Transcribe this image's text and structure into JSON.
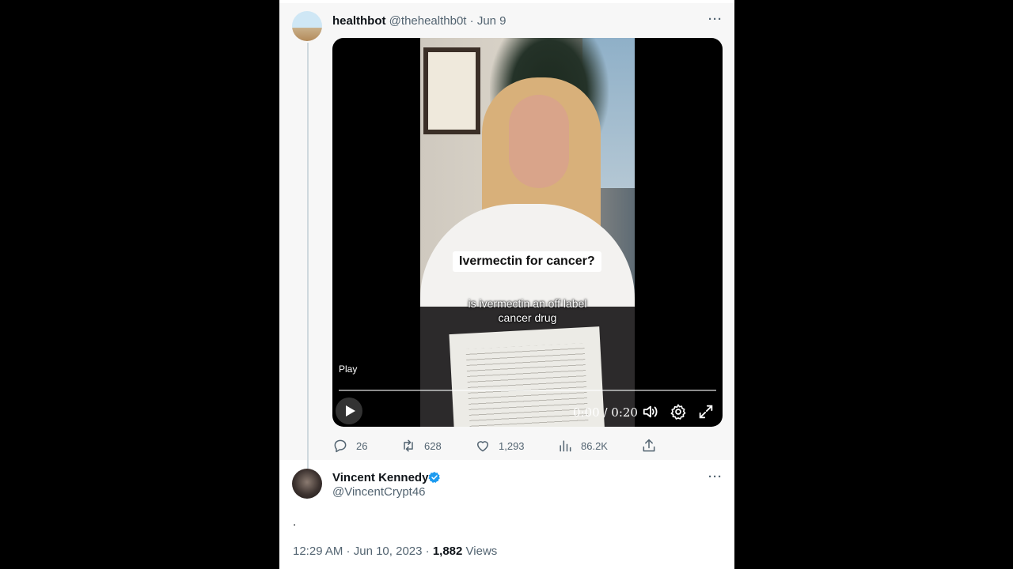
{
  "tweet1": {
    "display_name": "healthbot",
    "handle": "@thehealthb0t",
    "date": "Jun 9",
    "more_label": "···",
    "video": {
      "caption_title": "Ivermectin for cancer?",
      "subtitle_line1": "is ivermectin an off label",
      "subtitle_line2": "cancer drug",
      "play_label": "Play",
      "time": "0:00 / 0:20",
      "progress": 0
    },
    "actions": {
      "replies": "26",
      "reposts": "628",
      "likes": "1,293",
      "views": "86.2K"
    }
  },
  "tweet2": {
    "display_name": "Vincent Kennedy",
    "handle": "@VincentCrypt46",
    "more_label": "···",
    "body": ".",
    "time": "12:29 AM",
    "date": "Jun 10, 2023",
    "separator": " · ",
    "views_count": "1,882",
    "views_label": " Views"
  },
  "colors": {
    "accent": "#1d9bf0",
    "muted": "#536471",
    "text": "#0f1419"
  }
}
